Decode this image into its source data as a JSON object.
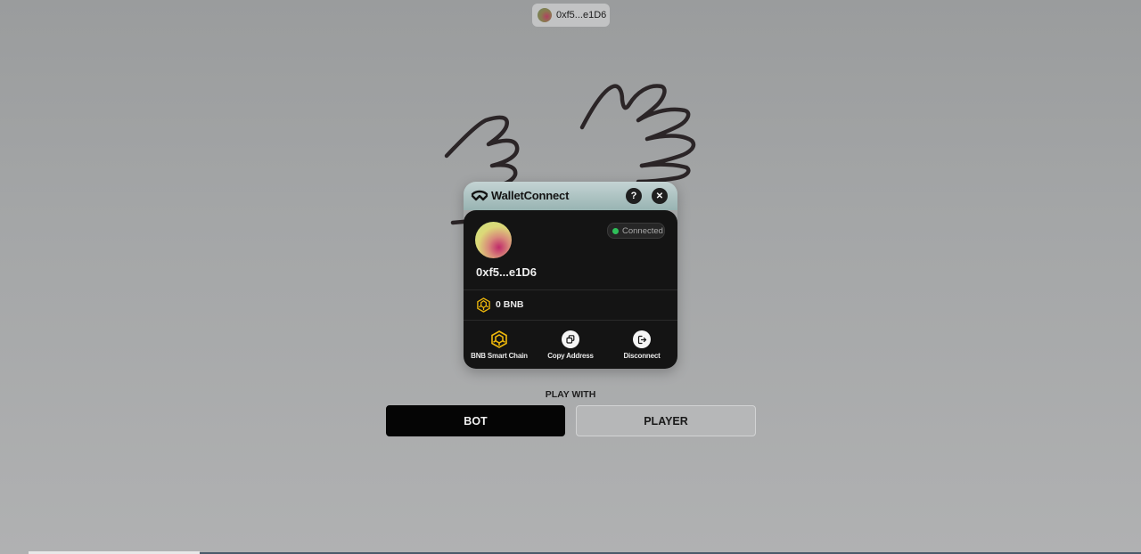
{
  "topbar": {
    "account_label": "0xf5...e1D6"
  },
  "wallet_modal": {
    "title": "WalletConnect",
    "help_glyph": "?",
    "close_glyph": "✕",
    "address": "0xf5...e1D6",
    "status": "Connected",
    "balance": "0 BNB",
    "actions": [
      {
        "label": "BNB Smart Chain",
        "icon": "bnb-chain-icon"
      },
      {
        "label": "Copy Address",
        "icon": "copy-icon"
      },
      {
        "label": "Disconnect",
        "icon": "disconnect-icon"
      }
    ],
    "colors": {
      "status_dot": "#2fc05a",
      "bnb_yellow": "#f0b90b",
      "modal_bg": "#141414"
    }
  },
  "game": {
    "play_with_label": "PLAY WITH",
    "modes": [
      {
        "label": "BOT",
        "selected": true
      },
      {
        "label": "PLAYER",
        "selected": false
      }
    ]
  }
}
